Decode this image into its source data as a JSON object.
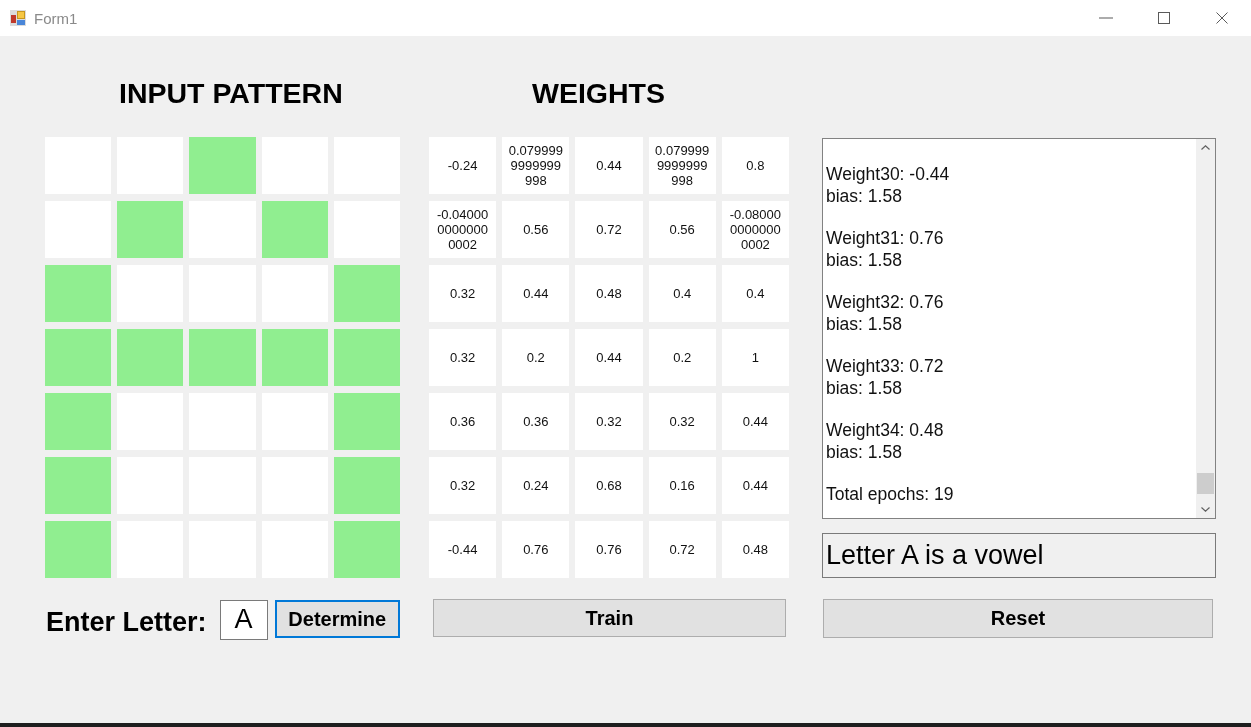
{
  "window": {
    "title": "Form1"
  },
  "input_pattern": {
    "title": "INPUT PATTERN",
    "rows": [
      {
        "cells": [
          {
            "on": false
          },
          {
            "on": false
          },
          {
            "on": true
          },
          {
            "on": false
          },
          {
            "on": false
          }
        ]
      },
      {
        "cells": [
          {
            "on": false
          },
          {
            "on": true
          },
          {
            "on": false
          },
          {
            "on": true
          },
          {
            "on": false
          }
        ]
      },
      {
        "cells": [
          {
            "on": true
          },
          {
            "on": false
          },
          {
            "on": false
          },
          {
            "on": false
          },
          {
            "on": true
          }
        ]
      },
      {
        "cells": [
          {
            "on": true
          },
          {
            "on": true
          },
          {
            "on": true
          },
          {
            "on": true
          },
          {
            "on": true
          }
        ]
      },
      {
        "cells": [
          {
            "on": true
          },
          {
            "on": false
          },
          {
            "on": false
          },
          {
            "on": false
          },
          {
            "on": true
          }
        ]
      },
      {
        "cells": [
          {
            "on": true
          },
          {
            "on": false
          },
          {
            "on": false
          },
          {
            "on": false
          },
          {
            "on": true
          }
        ]
      },
      {
        "cells": [
          {
            "on": true
          },
          {
            "on": false
          },
          {
            "on": false
          },
          {
            "on": false
          },
          {
            "on": true
          }
        ]
      }
    ]
  },
  "weights": {
    "title": "WEIGHTS",
    "rows": [
      [
        "-0.24",
        "0.0799999999999998",
        "0.44",
        "0.0799999999999998",
        "0.8"
      ],
      [
        "-0.0400000000000002",
        "0.56",
        "0.72",
        "0.56",
        "-0.0800000000000002"
      ],
      [
        "0.32",
        "0.44",
        "0.48",
        "0.4",
        "0.4"
      ],
      [
        "0.32",
        "0.2",
        "0.44",
        "0.2",
        "1"
      ],
      [
        "0.36",
        "0.36",
        "0.32",
        "0.32",
        "0.44"
      ],
      [
        "0.32",
        "0.24",
        "0.68",
        "0.16",
        "0.44"
      ],
      [
        "-0.44",
        "0.76",
        "0.76",
        "0.72",
        "0.48"
      ]
    ]
  },
  "log": {
    "entries": [
      {
        "weight": "Weight30: -0.44",
        "bias": "bias: 1.58"
      },
      {
        "weight": "Weight31: 0.76",
        "bias": "bias: 1.58"
      },
      {
        "weight": "Weight32: 0.76",
        "bias": "bias: 1.58"
      },
      {
        "weight": "Weight33: 0.72",
        "bias": "bias: 1.58"
      },
      {
        "weight": "Weight34: 0.48",
        "bias": "bias: 1.58"
      }
    ],
    "summary": "Total epochs: 19"
  },
  "result": {
    "value": "Letter A is a vowel"
  },
  "letter_entry": {
    "label": "Enter Letter:",
    "value": "A"
  },
  "determine_button": {
    "label": "Determine",
    "focused": true
  },
  "train_button": {
    "label": "Train",
    "focused": false
  },
  "reset_button": {
    "label": "Reset",
    "focused": false
  }
}
